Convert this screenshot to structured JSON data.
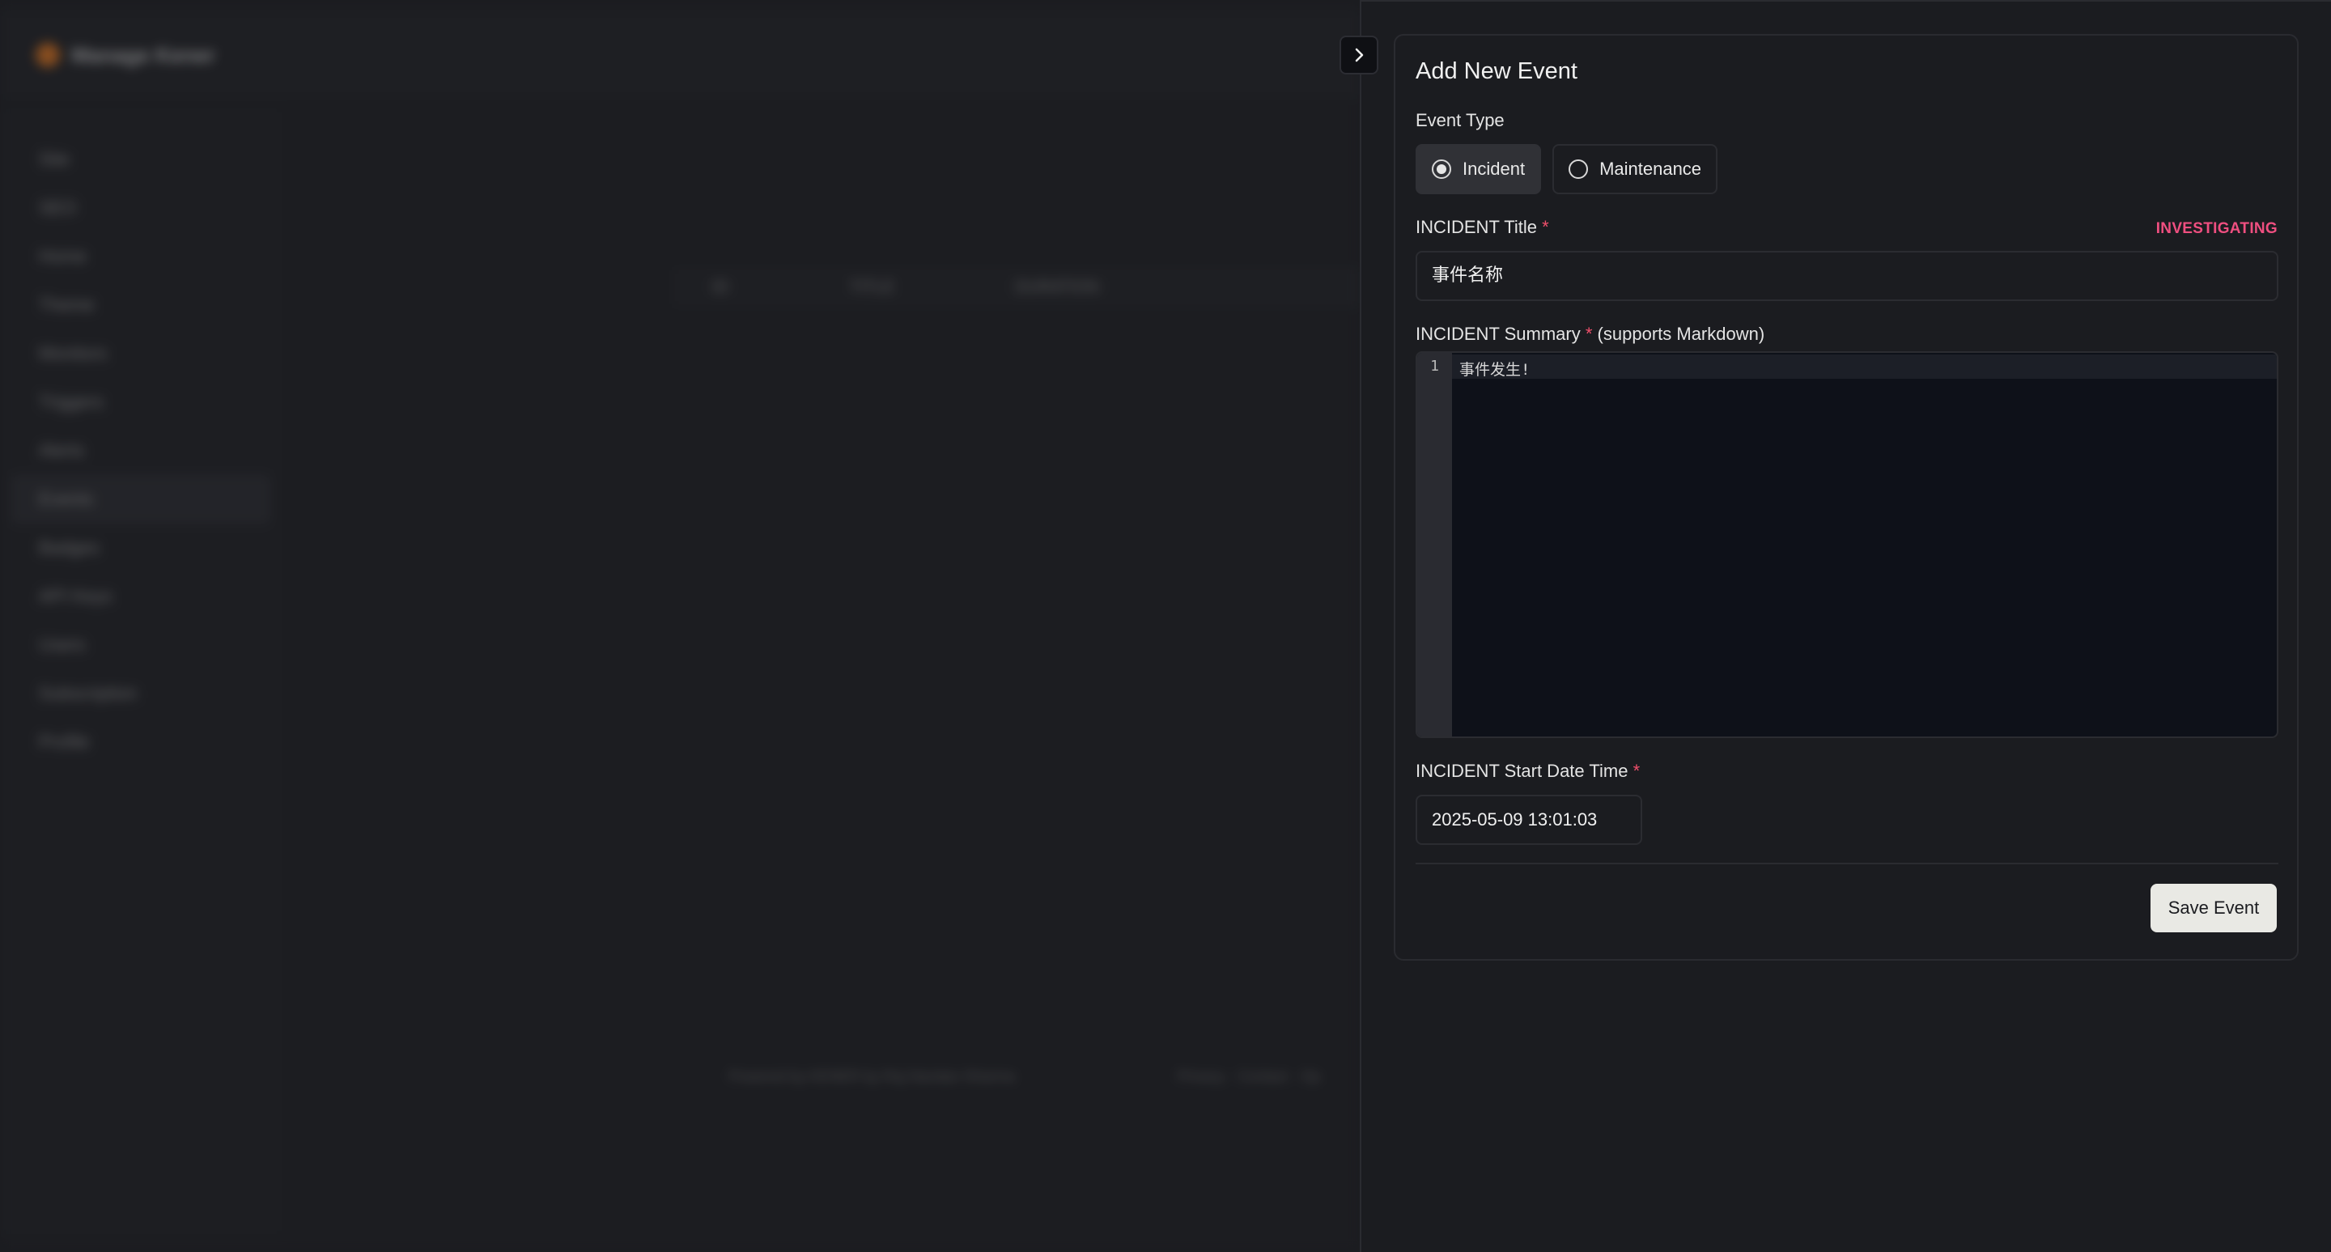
{
  "background": {
    "brand": "Manage Kener",
    "sidebar_items": [
      "Site",
      "SEO",
      "Home",
      "Theme",
      "Monitors",
      "Triggers",
      "Alerts",
      "Events",
      "Badges",
      "API Keys",
      "Users",
      "Subscription",
      "Profile"
    ],
    "active_item": "Events",
    "table_headers": [
      "ID",
      "TITLE",
      "DURATION"
    ],
    "footer_left": "Powered by KENER by Raj Nandan Sharma",
    "footer_right": "Privacy · Contact · Op"
  },
  "form": {
    "title": "Add New Event",
    "event_type_label": "Event Type",
    "event_types": [
      {
        "label": "Incident",
        "selected": true
      },
      {
        "label": "Maintenance",
        "selected": false
      }
    ],
    "title_label": "INCIDENT Title",
    "required_mark": "*",
    "status": "INVESTIGATING",
    "title_value": "事件名称",
    "summary_label": "INCIDENT Summary",
    "summary_hint": "(supports Markdown)",
    "editor_line_number": "1",
    "editor_content": "事件发生!",
    "start_label": "INCIDENT Start Date Time",
    "start_value": "2025-05-09 13:01:03",
    "save_label": "Save Event"
  },
  "colors": {
    "status": "#ef4f80",
    "required": "#ef4f6b",
    "save_button_bg": "#e9e9e4"
  },
  "icons": {
    "collapse": "chevron-right-icon"
  }
}
